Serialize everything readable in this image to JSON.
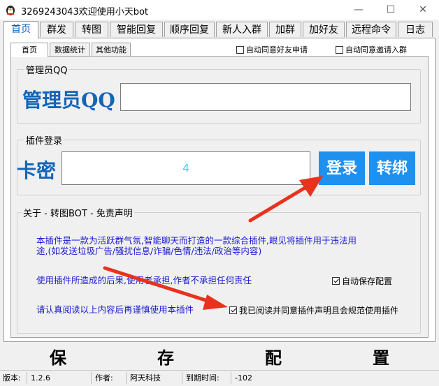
{
  "window": {
    "title": "3269243043欢迎使用小天bot",
    "minimize": "—",
    "maximize": "☐",
    "close": "✕"
  },
  "main_tabs": [
    "首页",
    "群发",
    "转图",
    "智能回复",
    "顺序回复",
    "新人入群",
    "加群",
    "加好友",
    "远程命令",
    "日志"
  ],
  "sub_tabs": [
    "首页",
    "数据统计",
    "其他功能"
  ],
  "top_checks": {
    "auto_friend": "自动同意好友申请",
    "auto_invite": "自动同意邀请入群"
  },
  "admin": {
    "group_label": "管理员QQ",
    "big_label": "管理员QQ",
    "value": ""
  },
  "login": {
    "group_label": "插件登录",
    "big_label": "卡密",
    "value": "4",
    "login_btn": "登录",
    "bind_btn": "转绑"
  },
  "about": {
    "group_label": "关于 - 转图BOT - 免责声明",
    "line1": "本插件是一款为活跃群气氛,智能聊天而打造的一款综合插件,眼见将插件用于违法用",
    "line2": "途,(如发送垃圾广告/骚扰信息/诈骗/色情/违法/政治等内容)",
    "line3": "使用插件所造成的后果,使用者承担,作者不承担任何责任",
    "line4": "请认真阅读以上内容后再谨慎使用本插件",
    "auto_save": "自动保存配置",
    "agree": "我已阅读并同意插件声明且会规范使用插件",
    "auto_save_checked": true,
    "agree_checked": true
  },
  "save_button": [
    "保",
    "存",
    "配",
    "置"
  ],
  "status": {
    "version_label": "版本:",
    "version": "1.2.6",
    "author_label": "作者:",
    "author": "阿天科技",
    "expiry_label": "到期时间:",
    "expiry": "-102"
  },
  "colors": {
    "accent": "#1465b8",
    "button": "#1e90f0",
    "note_text": "#1a1ad0",
    "arrow": "#e8321e"
  }
}
